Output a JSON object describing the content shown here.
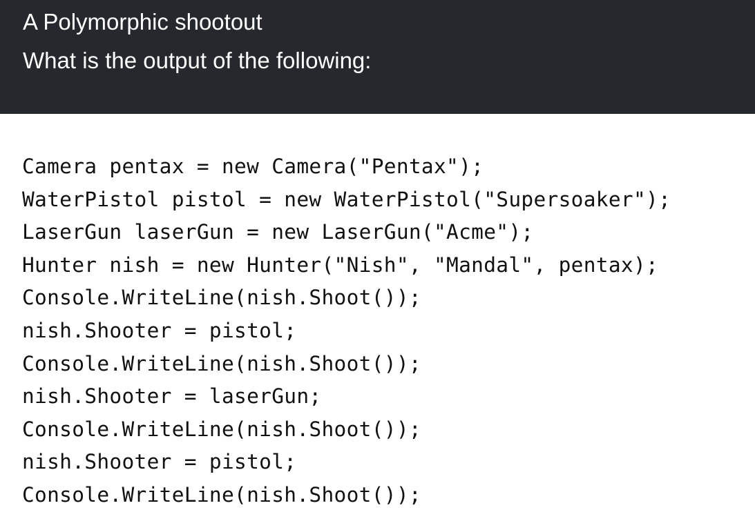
{
  "header": {
    "title": "A Polymorphic shootout",
    "subtitle": "What is the output of the following:",
    "background_color": "#25282d",
    "text_color": "#ffffff"
  },
  "code": {
    "lines": [
      "Camera pentax = new Camera(\"Pentax\");",
      "WaterPistol pistol = new WaterPistol(\"Supersoaker\");",
      "LaserGun laserGun = new LaserGun(\"Acme\");",
      "Hunter nish = new Hunter(\"Nish\", \"Mandal\", pentax);",
      "Console.WriteLine(nish.Shoot());",
      "nish.Shooter = pistol;",
      "Console.WriteLine(nish.Shoot());",
      "nish.Shooter = laserGun;",
      "Console.WriteLine(nish.Shoot());",
      "nish.Shooter = pistol;",
      "Console.WriteLine(nish.Shoot());"
    ]
  }
}
